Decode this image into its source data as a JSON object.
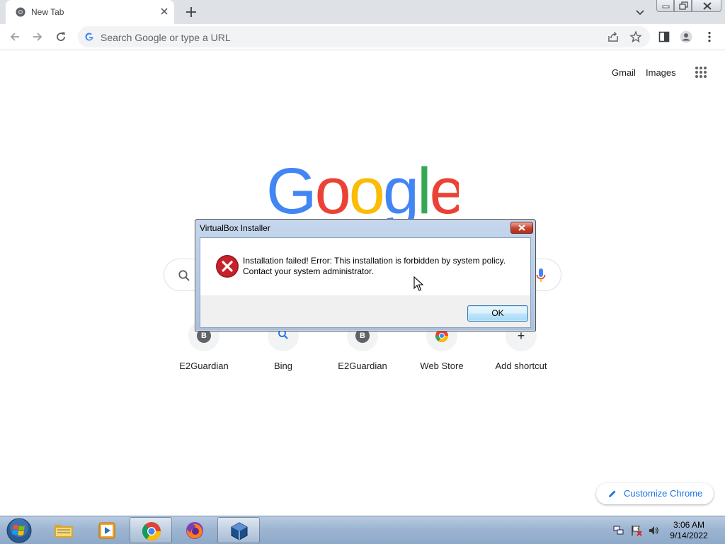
{
  "browser": {
    "tab": {
      "title": "New Tab"
    },
    "omnibox": {
      "placeholder": "Search Google or type a URL"
    }
  },
  "ntp": {
    "links": [
      "Gmail",
      "Images"
    ],
    "logo_text": "Google",
    "shortcuts": [
      {
        "label": "E2Guardian",
        "badge": "B"
      },
      {
        "label": "Bing",
        "badge": ""
      },
      {
        "label": "E2Guardian",
        "badge": "B"
      },
      {
        "label": "Web Store",
        "badge": ""
      },
      {
        "label": "Add shortcut",
        "badge": "+"
      }
    ],
    "customize_label": "Customize Chrome"
  },
  "dialog": {
    "title": "VirtualBox Installer",
    "message_line1": "Installation failed! Error: This installation is forbidden by system policy.",
    "message_line2": "Contact your system administrator.",
    "ok_label": "OK"
  },
  "taskbar": {
    "apps": [
      "windows-explorer",
      "media-player",
      "google-chrome",
      "firefox",
      "virtualbox-installer"
    ],
    "clock_time": "3:06 AM",
    "clock_date": "9/14/2022"
  },
  "colors": {
    "google_blue": "#4285f4",
    "google_red": "#ea4335",
    "google_yellow": "#fbbc05",
    "google_green": "#34a853",
    "accent_blue": "#1a73e8",
    "error_red": "#c8212a"
  }
}
